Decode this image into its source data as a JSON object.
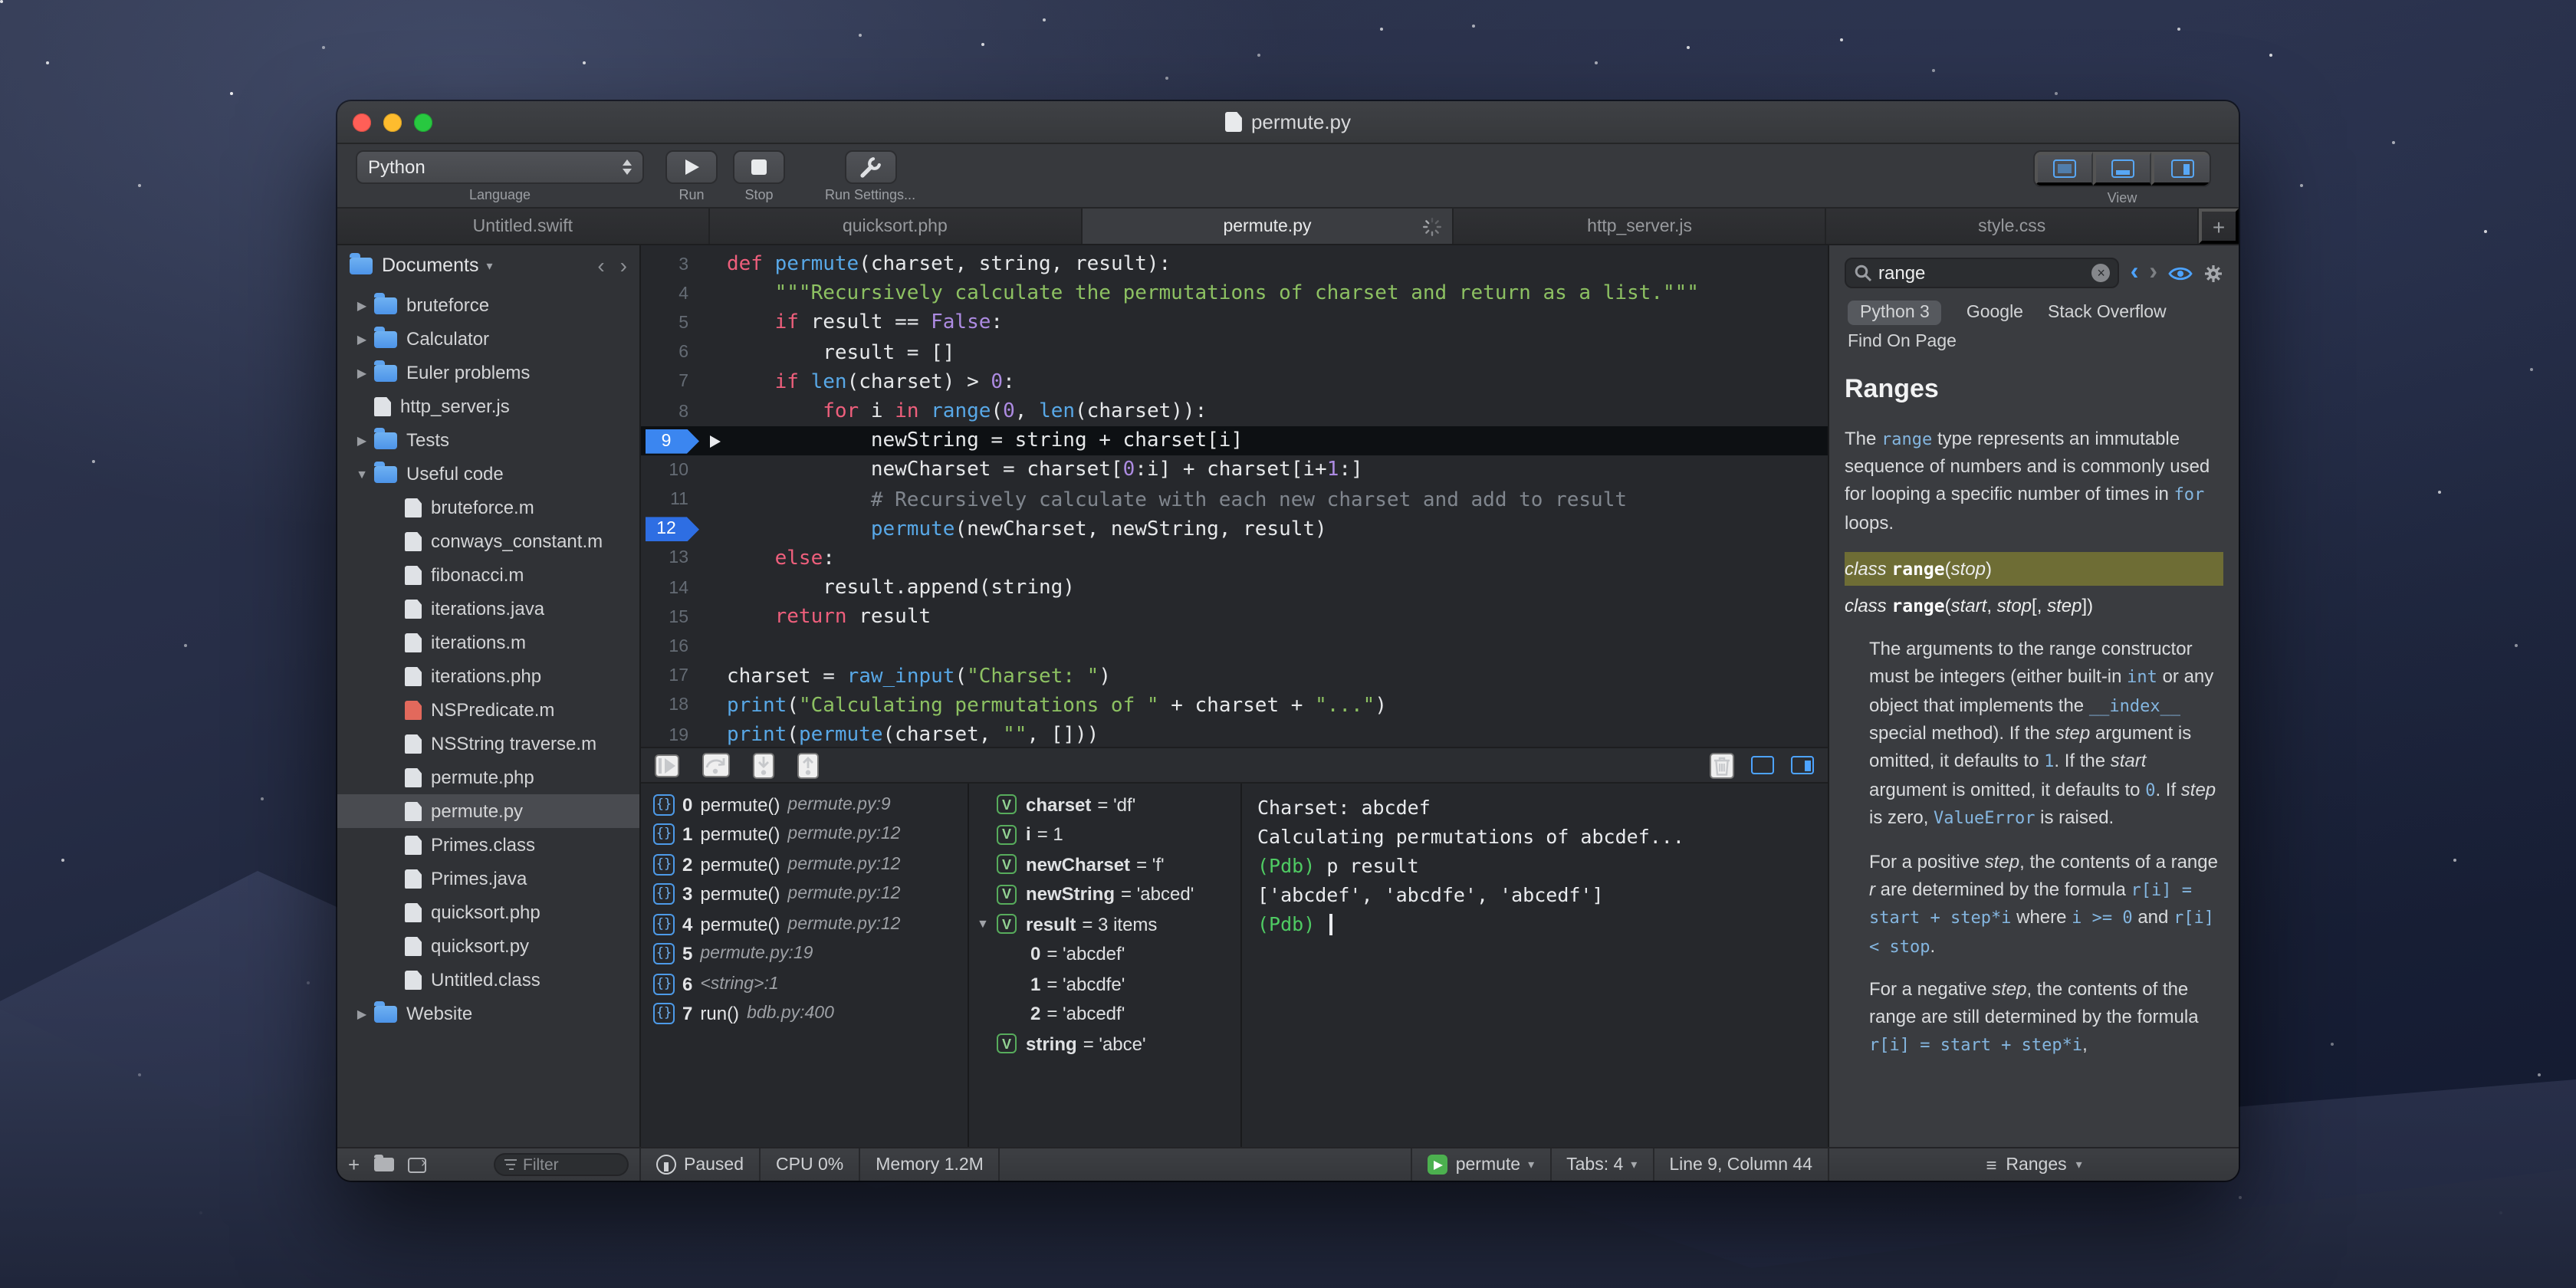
{
  "icons": {
    "chevron_down": "▾",
    "disclosure_collapsed": "▶",
    "disclosure_expanded": "▼",
    "back": "‹",
    "forward": "›",
    "close": "×",
    "add": "+",
    "menu": "≡"
  },
  "window": {
    "title": "permute.py",
    "toolbar": {
      "language_value": "Python",
      "language_label": "Language",
      "run_label": "Run",
      "stop_label": "Stop",
      "run_settings_label": "Run Settings...",
      "view_label": "View"
    },
    "tabs": [
      {
        "label": "Untitled.swift",
        "active": false,
        "spinner": false
      },
      {
        "label": "quicksort.php",
        "active": false,
        "spinner": false
      },
      {
        "label": "permute.py",
        "active": true,
        "spinner": true
      },
      {
        "label": "http_server.js",
        "active": false,
        "spinner": false
      },
      {
        "label": "style.css",
        "active": false,
        "spinner": false
      }
    ]
  },
  "sidebar": {
    "root": "Documents",
    "filter_placeholder": "Filter",
    "items": [
      {
        "label": "bruteforce",
        "icon": "folder",
        "depth": 1,
        "disclosure": "collapsed"
      },
      {
        "label": "Calculator",
        "icon": "folder",
        "depth": 1,
        "disclosure": "collapsed"
      },
      {
        "label": "Euler problems",
        "icon": "folder",
        "depth": 1,
        "disclosure": "collapsed"
      },
      {
        "label": "http_server.js",
        "icon": "file",
        "depth": 1,
        "disclosure": "none"
      },
      {
        "label": "Tests",
        "icon": "folder",
        "depth": 1,
        "disclosure": "collapsed"
      },
      {
        "label": "Useful code",
        "icon": "folder",
        "depth": 1,
        "disclosure": "expanded"
      },
      {
        "label": "bruteforce.m",
        "icon": "file",
        "depth": 2,
        "disclosure": "none"
      },
      {
        "label": "conways_constant.m",
        "icon": "file",
        "depth": 2,
        "disclosure": "none"
      },
      {
        "label": "fibonacci.m",
        "icon": "file",
        "depth": 2,
        "disclosure": "none"
      },
      {
        "label": "iterations.java",
        "icon": "file",
        "depth": 2,
        "disclosure": "none"
      },
      {
        "label": "iterations.m",
        "icon": "file",
        "depth": 2,
        "disclosure": "none"
      },
      {
        "label": "iterations.php",
        "icon": "file",
        "depth": 2,
        "disclosure": "none"
      },
      {
        "label": "NSPredicate.m",
        "icon": "file-red",
        "depth": 2,
        "disclosure": "none"
      },
      {
        "label": "NSString traverse.m",
        "icon": "file",
        "depth": 2,
        "disclosure": "none"
      },
      {
        "label": "permute.php",
        "icon": "file",
        "depth": 2,
        "disclosure": "none"
      },
      {
        "label": "permute.py",
        "icon": "file",
        "depth": 2,
        "disclosure": "none",
        "selected": true
      },
      {
        "label": "Primes.class",
        "icon": "file",
        "depth": 2,
        "disclosure": "none"
      },
      {
        "label": "Primes.java",
        "icon": "file",
        "depth": 2,
        "disclosure": "none"
      },
      {
        "label": "quicksort.php",
        "icon": "file",
        "depth": 2,
        "disclosure": "none"
      },
      {
        "label": "quicksort.py",
        "icon": "file",
        "depth": 2,
        "disclosure": "none"
      },
      {
        "label": "Untitled.class",
        "icon": "file",
        "depth": 2,
        "disclosure": "none"
      },
      {
        "label": "Website",
        "icon": "folder",
        "depth": 1,
        "disclosure": "collapsed"
      }
    ]
  },
  "editor": {
    "lines": [
      {
        "num": 3,
        "segments": [
          {
            "t": "def ",
            "c": "k"
          },
          {
            "t": "permute",
            "c": "f"
          },
          {
            "t": "(charset, string, result):",
            "c": "p"
          }
        ]
      },
      {
        "num": 4,
        "segments": [
          {
            "t": "    ",
            "c": "p"
          },
          {
            "t": "\"\"\"Recursively calculate the permutations of charset and return as a list.\"\"\"",
            "c": "s"
          }
        ]
      },
      {
        "num": 5,
        "segments": [
          {
            "t": "    ",
            "c": "p"
          },
          {
            "t": "if",
            "c": "k"
          },
          {
            "t": " result == ",
            "c": "p"
          },
          {
            "t": "False",
            "c": "n"
          },
          {
            "t": ":",
            "c": "p"
          }
        ]
      },
      {
        "num": 6,
        "segments": [
          {
            "t": "        result = []",
            "c": "p"
          }
        ]
      },
      {
        "num": 7,
        "segments": [
          {
            "t": "    ",
            "c": "p"
          },
          {
            "t": "if",
            "c": "k"
          },
          {
            "t": " ",
            "c": "p"
          },
          {
            "t": "len",
            "c": "f"
          },
          {
            "t": "(charset) > ",
            "c": "p"
          },
          {
            "t": "0",
            "c": "n"
          },
          {
            "t": ":",
            "c": "p"
          }
        ]
      },
      {
        "num": 8,
        "segments": [
          {
            "t": "        ",
            "c": "p"
          },
          {
            "t": "for",
            "c": "k"
          },
          {
            "t": " i ",
            "c": "p"
          },
          {
            "t": "in",
            "c": "k"
          },
          {
            "t": " ",
            "c": "p"
          },
          {
            "t": "range",
            "c": "f"
          },
          {
            "t": "(",
            "c": "p"
          },
          {
            "t": "0",
            "c": "n"
          },
          {
            "t": ", ",
            "c": "p"
          },
          {
            "t": "len",
            "c": "f"
          },
          {
            "t": "(charset)):",
            "c": "p"
          }
        ]
      },
      {
        "num": 9,
        "current": true,
        "breakpoint": true,
        "segments": [
          {
            "t": "            newString = string + charset[i]",
            "c": "p"
          }
        ]
      },
      {
        "num": 10,
        "segments": [
          {
            "t": "            newCharset = charset[",
            "c": "p"
          },
          {
            "t": "0",
            "c": "n"
          },
          {
            "t": ":i] + charset[i+",
            "c": "p"
          },
          {
            "t": "1",
            "c": "n"
          },
          {
            "t": ":]",
            "c": "p"
          }
        ]
      },
      {
        "num": 11,
        "segments": [
          {
            "t": "            ",
            "c": "p"
          },
          {
            "t": "# Recursively calculate with each new charset and add to result",
            "c": "c"
          }
        ]
      },
      {
        "num": 12,
        "breakpoint": true,
        "segments": [
          {
            "t": "            ",
            "c": "p"
          },
          {
            "t": "permute",
            "c": "f"
          },
          {
            "t": "(newCharset, newString, result)",
            "c": "p"
          }
        ]
      },
      {
        "num": 13,
        "segments": [
          {
            "t": "    ",
            "c": "p"
          },
          {
            "t": "else",
            "c": "k"
          },
          {
            "t": ":",
            "c": "p"
          }
        ]
      },
      {
        "num": 14,
        "segments": [
          {
            "t": "        result.append(string)",
            "c": "p"
          }
        ]
      },
      {
        "num": 15,
        "segments": [
          {
            "t": "    ",
            "c": "p"
          },
          {
            "t": "return",
            "c": "k"
          },
          {
            "t": " result",
            "c": "p"
          }
        ]
      },
      {
        "num": 16,
        "segments": []
      },
      {
        "num": 17,
        "segments": [
          {
            "t": "charset = ",
            "c": "p"
          },
          {
            "t": "raw_input",
            "c": "f"
          },
          {
            "t": "(",
            "c": "p"
          },
          {
            "t": "\"Charset: \"",
            "c": "s"
          },
          {
            "t": ")",
            "c": "p"
          }
        ]
      },
      {
        "num": 18,
        "segments": [
          {
            "t": "print",
            "c": "f"
          },
          {
            "t": "(",
            "c": "p"
          },
          {
            "t": "\"Calculating permutations of \"",
            "c": "s"
          },
          {
            "t": " + charset + ",
            "c": "p"
          },
          {
            "t": "\"...\"",
            "c": "s"
          },
          {
            "t": ")",
            "c": "p"
          }
        ]
      },
      {
        "num": 19,
        "segments": [
          {
            "t": "print",
            "c": "f"
          },
          {
            "t": "(",
            "c": "p"
          },
          {
            "t": "permute",
            "c": "f"
          },
          {
            "t": "(charset, ",
            "c": "p"
          },
          {
            "t": "\"\"",
            "c": "s"
          },
          {
            "t": ", []))",
            "c": "p"
          }
        ]
      }
    ]
  },
  "debugger": {
    "stack": [
      {
        "index": "0",
        "func": "permute()",
        "loc": "permute.py:9"
      },
      {
        "index": "1",
        "func": "permute()",
        "loc": "permute.py:12"
      },
      {
        "index": "2",
        "func": "permute()",
        "loc": "permute.py:12"
      },
      {
        "index": "3",
        "func": "permute()",
        "loc": "permute.py:12"
      },
      {
        "index": "4",
        "func": "permute()",
        "loc": "permute.py:12"
      },
      {
        "index": "5",
        "func": "",
        "loc": "permute.py:19"
      },
      {
        "index": "6",
        "func": "",
        "loc": "<string>:1"
      },
      {
        "index": "7",
        "func": "run()",
        "loc": "bdb.py:400"
      }
    ],
    "variables": [
      {
        "name": "charset",
        "value": "'df'"
      },
      {
        "name": "i",
        "value": "1"
      },
      {
        "name": "newCharset",
        "value": "'f'"
      },
      {
        "name": "newString",
        "value": "'abced'"
      },
      {
        "name": "result",
        "value": "3 items",
        "expanded": true,
        "children": [
          {
            "name": "0",
            "value": "'abcdef'"
          },
          {
            "name": "1",
            "value": "'abcdfe'"
          },
          {
            "name": "2",
            "value": "'abcedf'"
          }
        ]
      },
      {
        "name": "string",
        "value": "'abce'"
      }
    ],
    "console": [
      {
        "segments": [
          {
            "t": "Charset: abcdef",
            "c": "out"
          }
        ]
      },
      {
        "segments": [
          {
            "t": "Calculating permutations of abcdef...",
            "c": "out"
          }
        ]
      },
      {
        "segments": [
          {
            "t": "(Pdb) ",
            "c": "pdb"
          },
          {
            "t": "p result",
            "c": "out"
          }
        ]
      },
      {
        "segments": [
          {
            "t": "['abcdef', 'abcdfe', 'abcedf']",
            "c": "out"
          }
        ]
      },
      {
        "segments": [
          {
            "t": "(Pdb) ",
            "c": "pdb"
          }
        ],
        "cursor": true
      }
    ]
  },
  "docs": {
    "search_value": "range",
    "tabs": [
      {
        "label": "Python 3",
        "selected": true
      },
      {
        "label": "Google",
        "selected": false
      },
      {
        "label": "Stack Overflow",
        "selected": false
      },
      {
        "label": "Find On Page",
        "selected": false
      }
    ],
    "title": "Ranges",
    "blocks": [
      {
        "style": "para",
        "segments": [
          {
            "t": "The "
          },
          {
            "t": "range",
            "c": "code"
          },
          {
            "t": " type represents an immutable sequence of numbers and is commonly used for looping a specific number of times in "
          },
          {
            "t": "for",
            "c": "code"
          },
          {
            "t": " loops."
          }
        ]
      },
      {
        "style": "sig-highlight",
        "segments": [
          {
            "t": "class ",
            "c": "italic"
          },
          {
            "t": "range",
            "c": "bold"
          },
          {
            "t": "("
          },
          {
            "t": "stop",
            "c": "italic"
          },
          {
            "t": ")"
          }
        ]
      },
      {
        "style": "sig",
        "segments": [
          {
            "t": "class ",
            "c": "italic"
          },
          {
            "t": "range",
            "c": "bold"
          },
          {
            "t": "("
          },
          {
            "t": "start",
            "c": "italic"
          },
          {
            "t": ", "
          },
          {
            "t": "stop",
            "c": "italic"
          },
          {
            "t": "[, "
          },
          {
            "t": "step",
            "c": "italic"
          },
          {
            "t": "])"
          }
        ]
      },
      {
        "style": "para-indent",
        "segments": [
          {
            "t": "The arguments to the range constructor must be integers (either built-in "
          },
          {
            "t": "int",
            "c": "code"
          },
          {
            "t": " or any object that implements the "
          },
          {
            "t": "__index__",
            "c": "code"
          },
          {
            "t": " special method). If the "
          },
          {
            "t": "step",
            "c": "italic"
          },
          {
            "t": " argument is omitted, it defaults to "
          },
          {
            "t": "1",
            "c": "code"
          },
          {
            "t": ". If the "
          },
          {
            "t": "start",
            "c": "italic"
          },
          {
            "t": " argument is omitted, it defaults to "
          },
          {
            "t": "0",
            "c": "code"
          },
          {
            "t": ". If "
          },
          {
            "t": "step",
            "c": "italic"
          },
          {
            "t": " is zero, "
          },
          {
            "t": "ValueError",
            "c": "code-err"
          },
          {
            "t": " is raised."
          }
        ]
      },
      {
        "style": "para-indent",
        "segments": [
          {
            "t": "For a positive "
          },
          {
            "t": "step",
            "c": "italic"
          },
          {
            "t": ", the contents of a range "
          },
          {
            "t": "r",
            "c": "italic"
          },
          {
            "t": " are determined by the formula "
          },
          {
            "t": "r[i] = start + step*i",
            "c": "code"
          },
          {
            "t": " where "
          },
          {
            "t": "i >= 0",
            "c": "code"
          },
          {
            "t": " and "
          },
          {
            "t": "r[i] < stop",
            "c": "code"
          },
          {
            "t": "."
          }
        ]
      },
      {
        "style": "para-indent",
        "segments": [
          {
            "t": "For a negative "
          },
          {
            "t": "step",
            "c": "italic"
          },
          {
            "t": ", the contents of the range are still determined by the formula "
          },
          {
            "t": "r[i] = start + step*i",
            "c": "code"
          },
          {
            "t": ","
          }
        ]
      }
    ]
  },
  "statusbar": {
    "paused": "Paused",
    "cpu": "CPU 0%",
    "memory": "Memory 1.2M",
    "target": "permute",
    "tabs_count": "Tabs: 4",
    "position": "Line 9, Column 44",
    "docs_mode": "Ranges"
  }
}
